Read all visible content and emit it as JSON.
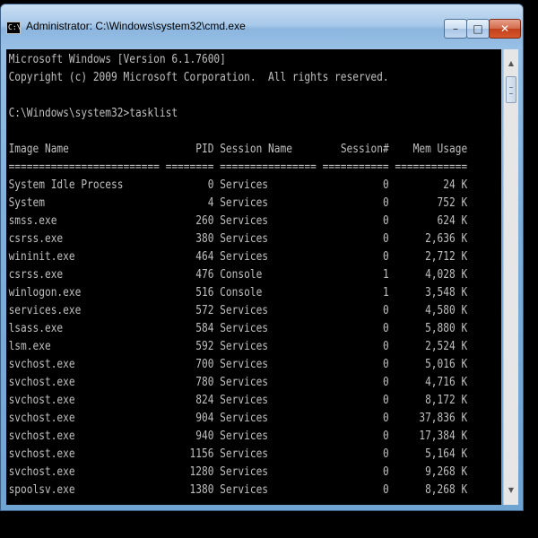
{
  "window": {
    "title": "Administrator: C:\\Windows\\system32\\cmd.exe",
    "app_icon_text": "C:\\",
    "controls": {
      "minimize": "–",
      "maximize": "□",
      "close": "✕"
    }
  },
  "console": {
    "header_line1": "Microsoft Windows [Version 6.1.7600]",
    "header_line2": "Copyright (c) 2009 Microsoft Corporation.  All rights reserved.",
    "prompt": "C:\\Windows\\system32>",
    "command": "tasklist",
    "columns": [
      "Image Name",
      "PID",
      "Session Name",
      "Session#",
      "Mem Usage"
    ],
    "separator": "========================= ======== ================ =========== ============",
    "rows": [
      [
        "System Idle Process",
        "0",
        "Services",
        "0",
        "24 K"
      ],
      [
        "System",
        "4",
        "Services",
        "0",
        "752 K"
      ],
      [
        "smss.exe",
        "260",
        "Services",
        "0",
        "624 K"
      ],
      [
        "csrss.exe",
        "380",
        "Services",
        "0",
        "2,636 K"
      ],
      [
        "wininit.exe",
        "464",
        "Services",
        "0",
        "2,712 K"
      ],
      [
        "csrss.exe",
        "476",
        "Console",
        "1",
        "4,028 K"
      ],
      [
        "winlogon.exe",
        "516",
        "Console",
        "1",
        "3,548 K"
      ],
      [
        "services.exe",
        "572",
        "Services",
        "0",
        "4,580 K"
      ],
      [
        "lsass.exe",
        "584",
        "Services",
        "0",
        "5,880 K"
      ],
      [
        "lsm.exe",
        "592",
        "Services",
        "0",
        "2,524 K"
      ],
      [
        "svchost.exe",
        "700",
        "Services",
        "0",
        "5,016 K"
      ],
      [
        "svchost.exe",
        "780",
        "Services",
        "0",
        "4,716 K"
      ],
      [
        "svchost.exe",
        "824",
        "Services",
        "0",
        "8,172 K"
      ],
      [
        "svchost.exe",
        "904",
        "Services",
        "0",
        "37,836 K"
      ],
      [
        "svchost.exe",
        "940",
        "Services",
        "0",
        "17,384 K"
      ],
      [
        "svchost.exe",
        "1156",
        "Services",
        "0",
        "5,164 K"
      ],
      [
        "svchost.exe",
        "1280",
        "Services",
        "0",
        "9,268 K"
      ],
      [
        "spoolsv.exe",
        "1380",
        "Services",
        "0",
        "8,268 K"
      ]
    ]
  },
  "scrollbar": {
    "up_icon": "scroll-up-arrow-icon",
    "down_icon": "scroll-down-arrow-icon"
  }
}
